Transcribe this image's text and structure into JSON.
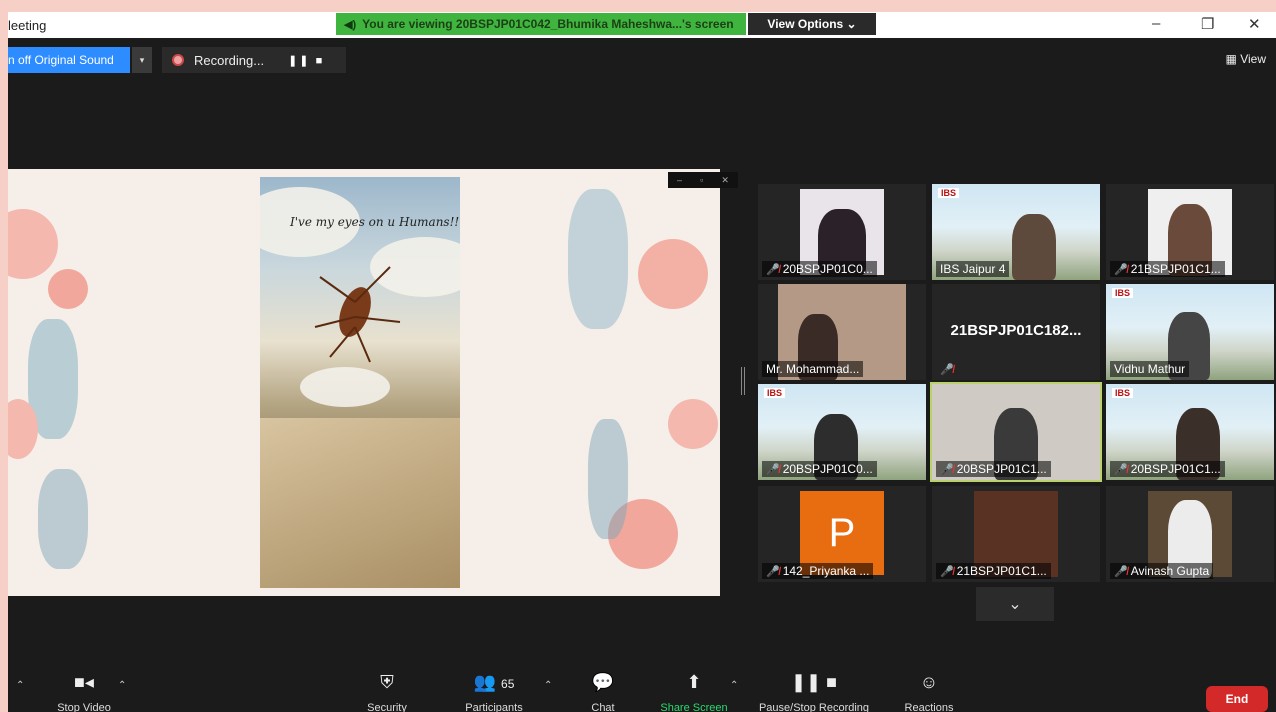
{
  "window": {
    "title": "leeting",
    "controls": [
      "–",
      "❐",
      "✕"
    ]
  },
  "banner": {
    "viewing_text": "You are viewing 20BSPJP01C042_Bhumika Maheshwa...'s screen",
    "view_options": "View Options ⌄"
  },
  "toolbar": {
    "original_sound": "n off Original Sound",
    "caret": "▾",
    "recording": "Recording...",
    "rec_controls": "❚❚ ■",
    "view_label": "View"
  },
  "shared_screen": {
    "caption": "I've my eyes on u Humans!!",
    "controls": [
      "–",
      "▫",
      "✕"
    ]
  },
  "participants": [
    {
      "name": "20BSPJP01C0...",
      "muted": true
    },
    {
      "name": "IBS Jaipur 4",
      "muted": false
    },
    {
      "name": "21BSPJP01C1...",
      "muted": true
    },
    {
      "name": "Mr. Mohammad...",
      "muted": false
    },
    {
      "name": "21BSPJP01C182...",
      "muted": true
    },
    {
      "name": "Vidhu Mathur",
      "muted": false
    },
    {
      "name": "20BSPJP01C0...",
      "muted": true
    },
    {
      "name": "20BSPJP01C1...",
      "muted": true
    },
    {
      "name": "20BSPJP01C1...",
      "muted": true
    },
    {
      "name": "142_Priyanka ...",
      "muted": true,
      "avatar_letter": "P"
    },
    {
      "name": "21BSPJP01C1...",
      "muted": true
    },
    {
      "name": "Avinash Gupta",
      "muted": true
    }
  ],
  "ibs_tag": "IBS",
  "grid_nav": "⌄",
  "bottom_bar": {
    "stop_video": "Stop Video",
    "security": "Security",
    "participants": "Participants",
    "participants_count": "65",
    "chat": "Chat",
    "share_screen": "Share Screen",
    "pause_recording": "Pause/Stop Recording",
    "reactions": "Reactions",
    "end": "End"
  },
  "colors": {
    "accent_blue": "#2d8cff",
    "share_green": "#3fb53f",
    "end_red": "#d42929",
    "active_tile": "#b9d36a"
  }
}
